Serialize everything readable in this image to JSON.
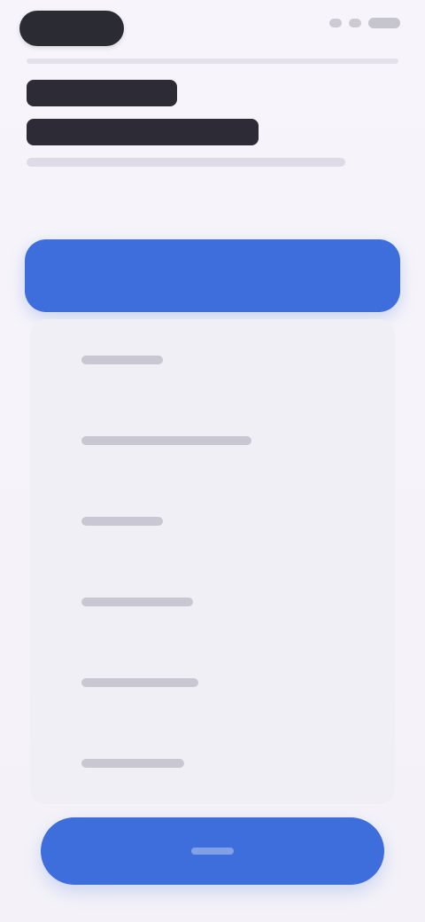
{
  "status_bar": {
    "left_pill": "",
    "right_icons": [
      "signal-icon",
      "wifi-icon",
      "battery-icon"
    ]
  },
  "header": {
    "title_line_1": "",
    "title_line_2": "",
    "subtitle": ""
  },
  "primary_action": {
    "label": ""
  },
  "list": {
    "items": [
      {
        "label": ""
      },
      {
        "label": ""
      },
      {
        "label": ""
      },
      {
        "label": ""
      },
      {
        "label": ""
      },
      {
        "label": ""
      }
    ]
  },
  "bottom_action": {
    "label": ""
  },
  "colors": {
    "accent": "#3e6edc",
    "background": "#f4f2f8",
    "text_dark": "#2d2c36",
    "placeholder": "#c9c7d2"
  }
}
